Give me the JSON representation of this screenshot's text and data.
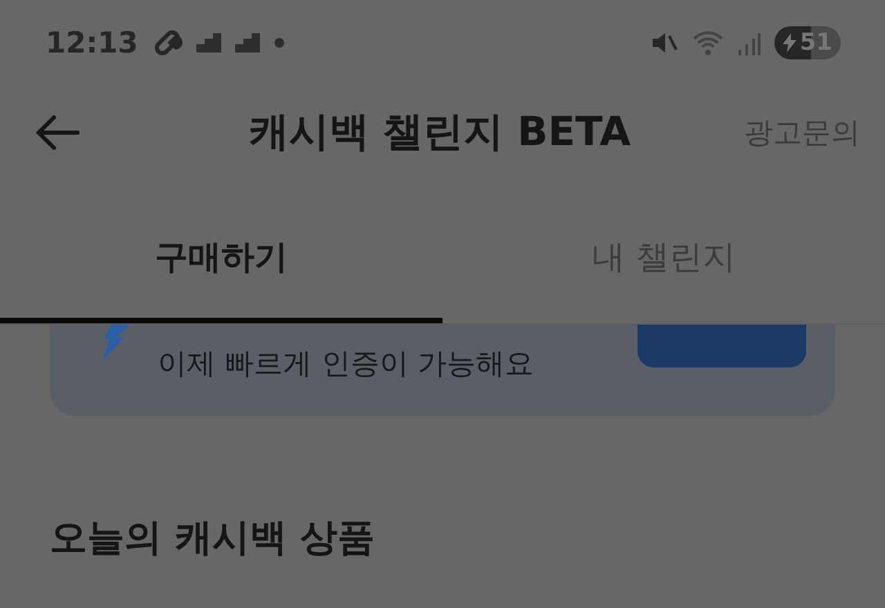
{
  "status_bar": {
    "time": "12:13",
    "battery": "51",
    "charging": true
  },
  "header": {
    "title": "캐시백 챌린지 BETA",
    "action": "광고문의"
  },
  "tabs": [
    {
      "label": "구매하기",
      "selected": true
    },
    {
      "label": "내 챌린지",
      "selected": false
    }
  ],
  "banner": {
    "text": "이제 빠르게 인증이 가능해요"
  },
  "section_title": "오늘의 캐시백 상품"
}
